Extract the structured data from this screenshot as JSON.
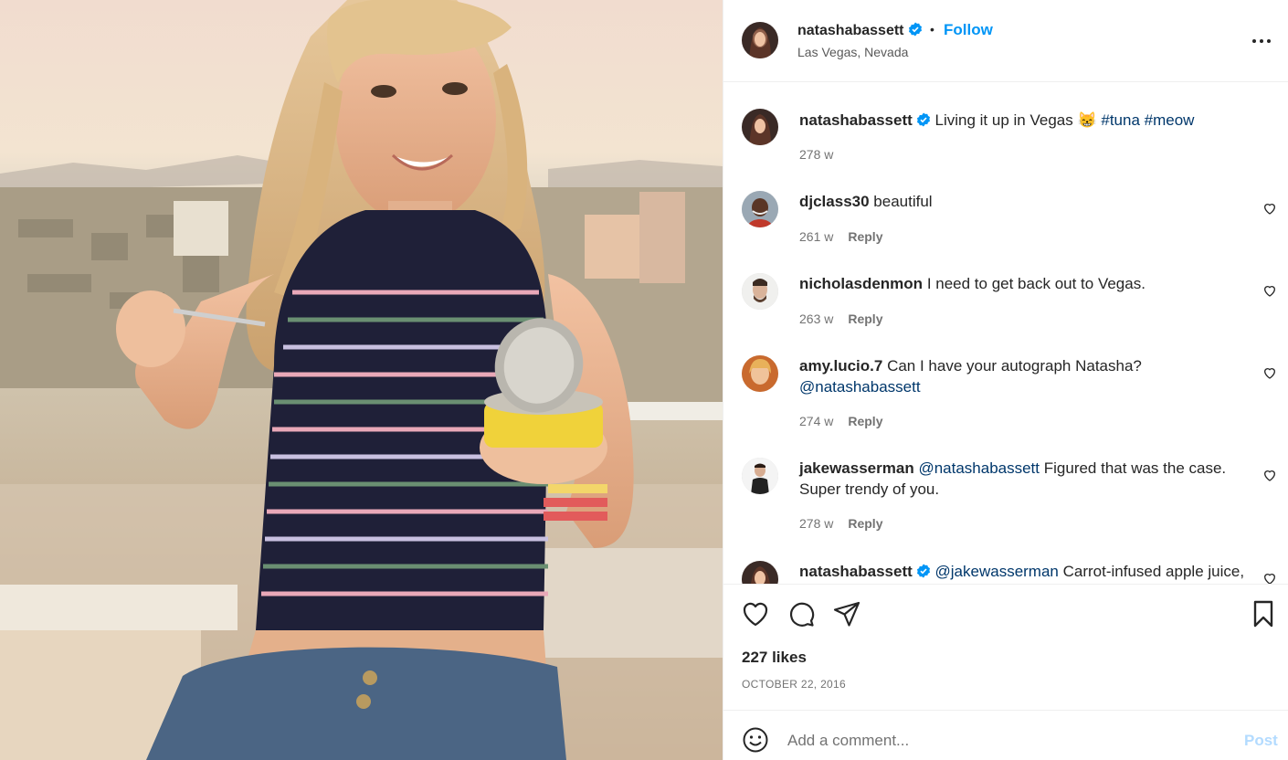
{
  "post": {
    "username": "natashabassett",
    "follow_label": "Follow",
    "dot": "•",
    "location": "Las Vegas, Nevada",
    "caption_prefix": "Living it up in Vegas ",
    "caption_emoji": "😸",
    "hashtags": [
      "#tuna",
      "#meow"
    ],
    "caption_time": "278 w"
  },
  "comments": [
    {
      "user": "djclass30",
      "text": "beautiful",
      "time": "261 w",
      "reply": "Reply"
    },
    {
      "user": "nicholasdenmon",
      "text": "I need to get back out to Vegas.",
      "time": "263 w",
      "reply": "Reply"
    },
    {
      "user": "amy.lucio.7",
      "text": "Can I have your autograph Natasha?",
      "mention": "@natashabassett",
      "time": "274 w",
      "reply": "Reply"
    },
    {
      "user": "jakewasserman",
      "mention": "@natashabassett",
      "text": "Figured that was the case. Super trendy of you.",
      "time": "278 w",
      "reply": "Reply"
    },
    {
      "user": "natashabassett",
      "mention": "@jakewasserman",
      "text": "Carrot-infused apple juice,"
    }
  ],
  "actions": {
    "likes": "227 likes",
    "date": "OCTOBER 22, 2016"
  },
  "comment_box": {
    "placeholder": "Add a comment...",
    "post_label": "Post"
  },
  "colors": {
    "accent": "#0095f6",
    "mention": "#00376b",
    "muted": "#737373",
    "post_disabled": "#b3dbff"
  },
  "icons": [
    "verified-badge-icon",
    "more-options-icon",
    "heart-icon",
    "comment-icon",
    "share-icon",
    "bookmark-icon",
    "emoji-icon"
  ]
}
